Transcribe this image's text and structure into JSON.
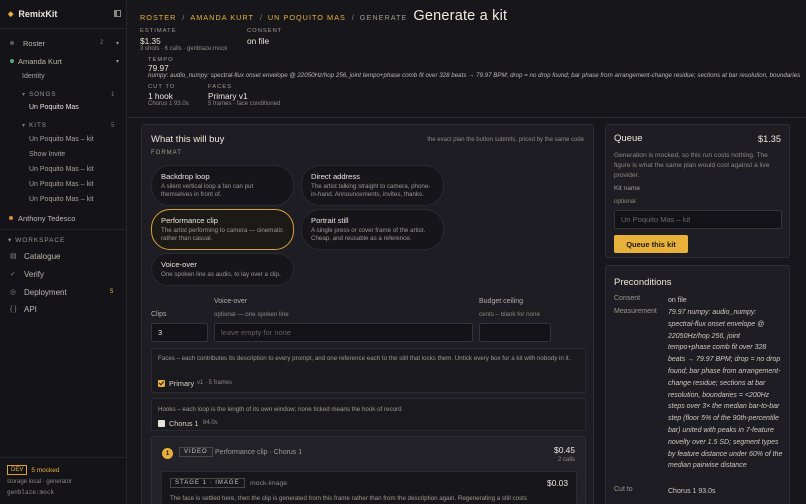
{
  "app": {
    "name": "RemixKit"
  },
  "sidebar": {
    "roster": {
      "label": "Roster",
      "count": "2"
    },
    "artist1": {
      "label": "Amanda Kurt"
    },
    "identity": "Identity",
    "songs": {
      "label": "SONGS",
      "count": "1",
      "items": [
        "Un Poquito Mas"
      ]
    },
    "kits": {
      "label": "KITS",
      "count": "5",
      "items": [
        "Un Poquito Mas – kit",
        "Show Invite",
        "Un Poquito Mas – kit",
        "Un Poquito Mas – kit",
        "Un Poquito Mas – kit"
      ]
    },
    "artist2": {
      "label": "Anthony Tedesco"
    },
    "workspace": {
      "label": "WORKSPACE",
      "items": [
        {
          "icon": "catalogue-icon",
          "glyph": "▤",
          "label": "Catalogue",
          "count": ""
        },
        {
          "icon": "check-icon",
          "glyph": "✓",
          "label": "Verify",
          "count": ""
        },
        {
          "icon": "deployment-icon",
          "glyph": "◎",
          "label": "Deployment",
          "count": "5"
        },
        {
          "icon": "api-icon",
          "glyph": "{ }",
          "label": "API",
          "count": ""
        }
      ]
    },
    "footer": {
      "env": "DEV",
      "mocked": "5 mocked",
      "storage": "storage local · generator",
      "generator": "genblaze:mock"
    }
  },
  "header": {
    "breadcrumb": [
      "ROSTER",
      "AMANDA KURT",
      "UN POQUITO MAS",
      "GENERATE"
    ],
    "title": "Generate a kit",
    "estimate": {
      "label": "ESTIMATE",
      "value": "$1.35",
      "meta": "3 shots · 6 calls · genblaze:mock"
    },
    "consent": {
      "label": "CONSENT",
      "value": "on file"
    },
    "tempo": {
      "label": "TEMPO",
      "value": "79.97",
      "detail": "numpy: audio_numpy: spectral-flux onset envelope @ 22050Hz/hop 256, joint tempo+phase comb fit over 328 beats → 79.97 BPM; drop = no drop found; bar phase from arrangement-change residue; sections at bar resolution, boundaries"
    },
    "cutto": {
      "label": "CUT TO",
      "value": "1 hook",
      "meta": "Chorus 1 93.0s"
    },
    "faces": {
      "label": "FACES",
      "value": "Primary v1",
      "meta": "5 frames · face conditioned"
    }
  },
  "buy": {
    "title": "What this will buy",
    "note": "the exact plan the button submits, priced by the same code",
    "format_label": "FORMAT",
    "formats": [
      {
        "title": "Backdrop loop",
        "desc": "A silent vertical loop a fan can put themselves in front of."
      },
      {
        "title": "Direct address",
        "desc": "The artist talking straight to camera, phone-in-hand. Announcements, invites, thanks."
      },
      {
        "title": "Performance clip",
        "desc": "The artist performing to camera — cinematic rather than casual."
      },
      {
        "title": "Portrait still",
        "desc": "A single press or cover frame of the artist. Cheap, and reusable as a reference."
      },
      {
        "title": "Voice-over",
        "desc": "One spoken line as audio, to lay over a clip."
      }
    ],
    "clips": {
      "label": "Clips",
      "value": "3"
    },
    "voiceover": {
      "label": "Voice-over",
      "sub": "optional — one spoken line",
      "placeholder": "leave empty for none"
    },
    "budget": {
      "label": "Budget ceiling",
      "sub": "cents – blank for none",
      "value": ""
    },
    "faces_text": "Faces – each contributes its description to every prompt, and one reference each to the still that locks them. Untick every box for a kit with nobody in it.",
    "face_item": {
      "label": "Primary",
      "meta": "v1 · 5 frames"
    },
    "hooks_text": "Hooks – each loop is the length of its own window; none ticked means the hook of record",
    "hook_item": {
      "label": "Chorus 1",
      "meta": "84.0s"
    },
    "shot": {
      "num": "1",
      "tag": "VIDEO",
      "title": "Performance clip · Chorus 1",
      "price": "$0.45",
      "calls": "2 calls"
    },
    "stage": {
      "tag": "STAGE 1 · IMAGE",
      "engine": "mock-image",
      "price": "$0.03",
      "desc": "The face is settled here, then the clip is generated from this frame rather than from the description again. Regenerating a still costs"
    }
  },
  "queue": {
    "title": "Queue",
    "price": "$1.35",
    "text": "Generation is mocked, so this run costs nothing. The figure is what the same plan would cost against a live provider.",
    "kit_label": "Kit name",
    "kit_sub": "optional",
    "kit_placeholder": "Un Poquito Mas – kit",
    "button": "Queue this kit"
  },
  "preconditions": {
    "title": "Preconditions",
    "consent": {
      "k": "Consent",
      "v": "on file"
    },
    "measurement": {
      "k": "Measurement",
      "v": "79.97 numpy: audio_numpy: spectral-flux onset envelope @ 22050Hz/hop 256, joint tempo+phase comb fit over 328 beats → 79.97 BPM; drop = no drop found; bar phase from arrangement-change residue; sections at bar resolution, boundaries = <200Hz steps over 3× the median bar-to-bar step (floor 5% of the 90th-percentile bar) united with peaks in 7-feature novelty over 1.5 SD; segment types by feature distance under 60% of the median pairwise distance"
    },
    "cutto": {
      "k": "Cut to",
      "v": "Chorus 1 93.0s"
    }
  }
}
